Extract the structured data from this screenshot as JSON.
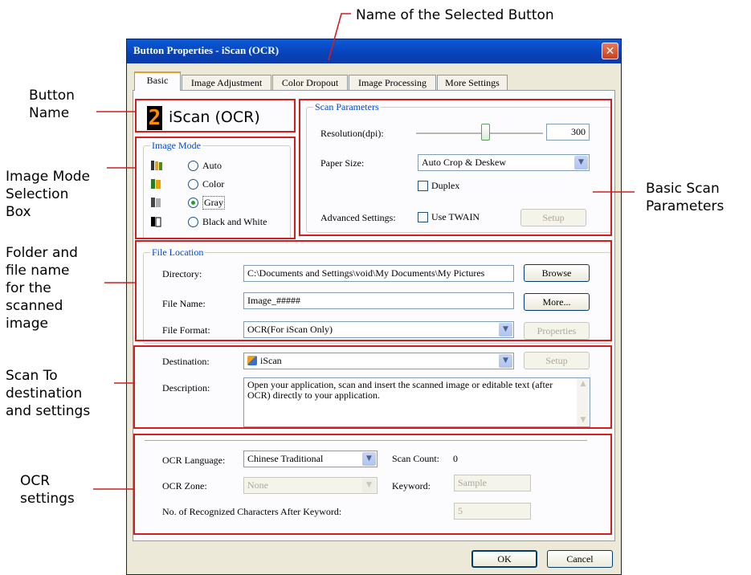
{
  "annotations": {
    "selected_button_name": "Name of the Selected Button",
    "button_name": [
      "Button",
      "Name"
    ],
    "image_mode_box": [
      "Image Mode",
      "Selection",
      "Box"
    ],
    "folder_file": [
      "Folder and",
      "file name",
      "for the",
      "scanned",
      "image"
    ],
    "scan_to": [
      "Scan To",
      "destination",
      "and settings"
    ],
    "ocr_settings": [
      "OCR",
      "settings"
    ],
    "basic_scan": [
      "Basic Scan",
      "Parameters"
    ]
  },
  "dialog": {
    "title": "Button Properties - iScan (OCR)",
    "close_glyph": "✕",
    "tabs": [
      "Basic",
      "Image Adjustment",
      "Color Dropout",
      "Image Processing",
      "More Settings"
    ],
    "active_tab": "Basic",
    "button_number": "2",
    "button_name": "iScan (OCR)",
    "image_mode": {
      "legend": "Image Mode",
      "options": [
        "Auto",
        "Color",
        "Gray",
        "Black and White"
      ],
      "selected": "Gray"
    },
    "scan_parameters": {
      "legend": "Scan Parameters",
      "resolution_label": "Resolution(dpi):",
      "resolution_value": "300",
      "resolution_fraction": 0.55,
      "paper_size_label": "Paper Size:",
      "paper_size_value": "Auto Crop & Deskew",
      "duplex_label": "Duplex",
      "advanced_label": "Advanced Settings:",
      "use_twain_label": "Use TWAIN",
      "setup_label": "Setup"
    },
    "file_location": {
      "legend": "File Location",
      "directory_label": "Directory:",
      "directory_value": "C:\\Documents and Settings\\void\\My Documents\\My Pictures",
      "browse_label": "Browse",
      "file_name_label": "File Name:",
      "file_name_value": "Image_#####",
      "more_label": "More...",
      "file_format_label": "File Format:",
      "file_format_value": "OCR(For iScan Only)",
      "properties_label": "Properties"
    },
    "destination": {
      "label": "Destination:",
      "value": "iScan",
      "setup_label": "Setup",
      "description_label": "Description:",
      "description_value": "Open your application, scan and insert the scanned image or editable text (after OCR) directly to your application."
    },
    "ocr": {
      "language_label": "OCR Language:",
      "language_value": "Chinese Traditional",
      "scan_count_label": "Scan Count:",
      "scan_count_value": "0",
      "zone_label": "OCR Zone:",
      "zone_value": "None",
      "keyword_label": "Keyword:",
      "keyword_value": "Sample",
      "chars_label": "No. of Recognized Characters After Keyword:",
      "chars_value": "5"
    },
    "ok_label": "OK",
    "cancel_label": "Cancel",
    "dropdown_glyph": "▼"
  }
}
